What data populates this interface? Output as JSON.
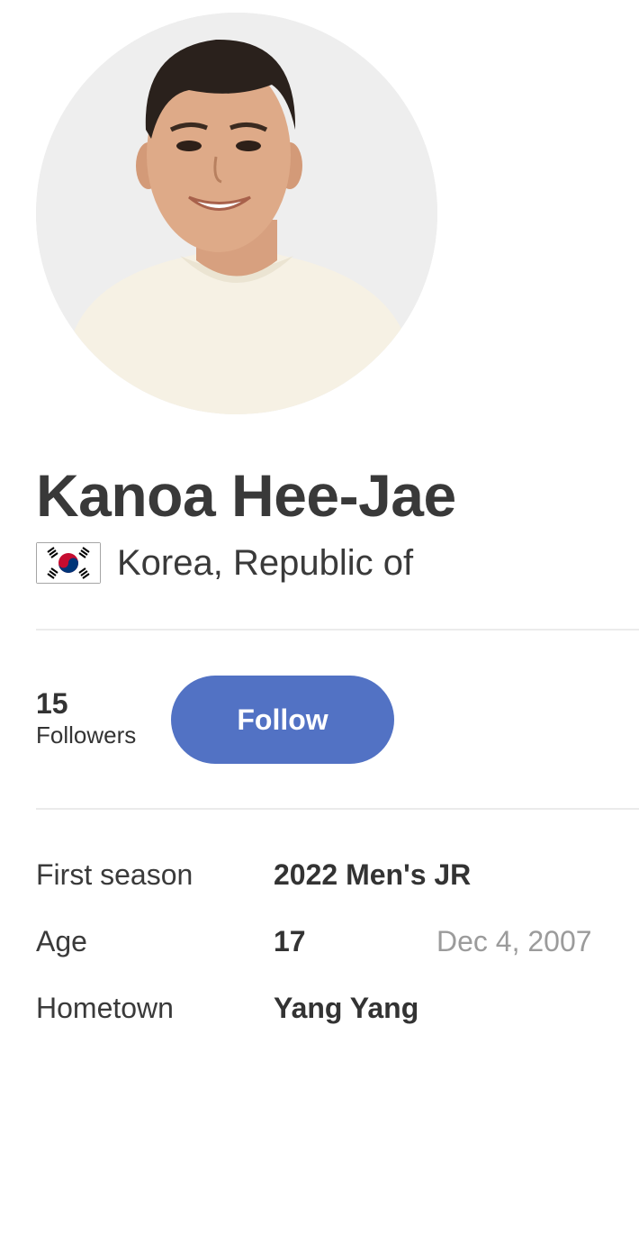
{
  "profile": {
    "name": "Kanoa Hee-Jae",
    "country": "Korea, Republic of",
    "flag_icon": "south-korea-flag-icon",
    "avatar_icon": "profile-photo"
  },
  "followers": {
    "count": "15",
    "label": "Followers"
  },
  "follow_button": {
    "label": "Follow",
    "color": "#5272c4"
  },
  "details": {
    "first_season": {
      "label": "First season",
      "value": "2022 Men's JR"
    },
    "age": {
      "label": "Age",
      "value": "17",
      "birthdate": "Dec 4, 2007"
    },
    "hometown": {
      "label": "Hometown",
      "value": "Yang Yang"
    }
  }
}
